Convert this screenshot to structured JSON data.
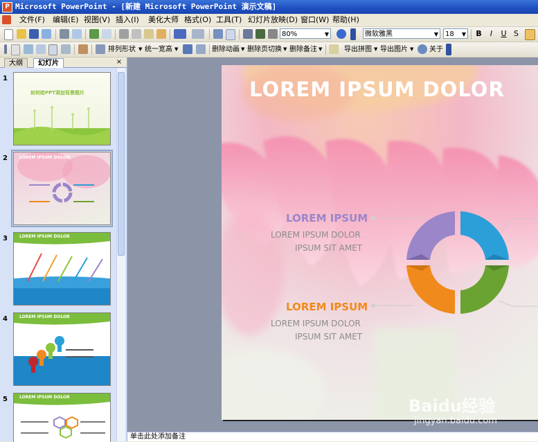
{
  "window": {
    "title": "Microsoft PowerPoint - [新建 Microsoft PowerPoint 演示文稿]"
  },
  "menu": [
    {
      "label": "文件(F)"
    },
    {
      "label": "编辑(E)"
    },
    {
      "label": "视图(V)"
    },
    {
      "label": "插入(I)"
    },
    {
      "label": "美化大师"
    },
    {
      "label": "格式(O)"
    },
    {
      "label": "工具(T)"
    },
    {
      "label": "幻灯片放映(D)"
    },
    {
      "label": "窗口(W)"
    },
    {
      "label": "帮助(H)"
    }
  ],
  "toolbar1": {
    "zoom": "80%",
    "font": "微软雅黑",
    "font_size": "18",
    "bold": "B",
    "italic": "I",
    "underline": "U",
    "shadow": "S"
  },
  "toolbar2": {
    "items": [
      "排列形状",
      "统一宽高",
      "删除动画",
      "删除页切换",
      "删除备注",
      "导出拼图",
      "导出图片",
      "关于"
    ]
  },
  "panel": {
    "tab_outline": "大纲",
    "tab_slides": "幻灯片",
    "close": "×"
  },
  "thumbnails": [
    {
      "number": "1",
      "title": "如何给PPT添加背景图片"
    },
    {
      "number": "2",
      "title": "LOREM IPSUM DOLOR"
    },
    {
      "number": "3",
      "title": "LOREM IPSUM DOLOR"
    },
    {
      "number": "4",
      "title": "LOREM IPSUM DOLOR"
    },
    {
      "number": "5",
      "title": "LOREM IPSUM DOLOR"
    }
  ],
  "slide": {
    "title": "LOREM IPSUM DOLOR",
    "block1": {
      "heading": "LOREM IPSUM",
      "line1": "LOREM IPSUM DOLOR",
      "line2": "IPSUM SIT AMET"
    },
    "block2": {
      "heading": "LOREM IPSUM",
      "line1": "LOREM IPSUM DOLOR",
      "line2": "IPSUM SIT AMET"
    },
    "colors": {
      "purple": "#9b86c9",
      "blue": "#2b9fd8",
      "orange": "#f08a1c",
      "green": "#6ba332"
    }
  },
  "notes": {
    "placeholder": "单击此处添加备注"
  },
  "watermark": {
    "brand": "Baidu经验",
    "url": "jingyan.baidu.com"
  }
}
